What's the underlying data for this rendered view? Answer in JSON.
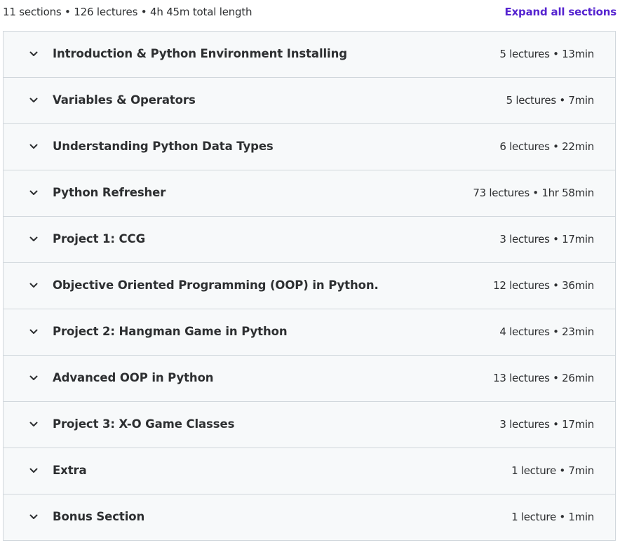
{
  "summary": {
    "text": "11 sections • 126 lectures • 4h 45m total length",
    "expand_label": "Expand all sections"
  },
  "colors": {
    "accent": "#5624d0",
    "row_background": "#f7f9fa",
    "border": "#d1d7dc",
    "text": "#2d2f31"
  },
  "sections": [
    {
      "title": "Introduction & Python Environment Installing",
      "meta": "5 lectures • 13min",
      "icon": "chevron-down-icon"
    },
    {
      "title": "Variables & Operators",
      "meta": "5 lectures • 7min",
      "icon": "chevron-down-icon"
    },
    {
      "title": "Understanding Python Data Types",
      "meta": "6 lectures • 22min",
      "icon": "chevron-down-icon"
    },
    {
      "title": "Python Refresher",
      "meta": "73 lectures • 1hr 58min",
      "icon": "chevron-down-icon"
    },
    {
      "title": "Project 1: CCG",
      "meta": "3 lectures • 17min",
      "icon": "chevron-down-icon"
    },
    {
      "title": "Objective Oriented Programming (OOP) in Python.",
      "meta": "12 lectures • 36min",
      "icon": "chevron-down-icon"
    },
    {
      "title": "Project 2: Hangman Game in Python",
      "meta": "4 lectures • 23min",
      "icon": "chevron-down-icon"
    },
    {
      "title": "Advanced OOP in Python",
      "meta": "13 lectures • 26min",
      "icon": "chevron-down-icon"
    },
    {
      "title": "Project 3: X-O Game Classes",
      "meta": "3 lectures • 17min",
      "icon": "chevron-down-icon"
    },
    {
      "title": "Extra",
      "meta": "1 lecture • 7min",
      "icon": "chevron-down-icon"
    },
    {
      "title": "Bonus Section",
      "meta": "1 lecture • 1min",
      "icon": "chevron-down-icon"
    }
  ]
}
